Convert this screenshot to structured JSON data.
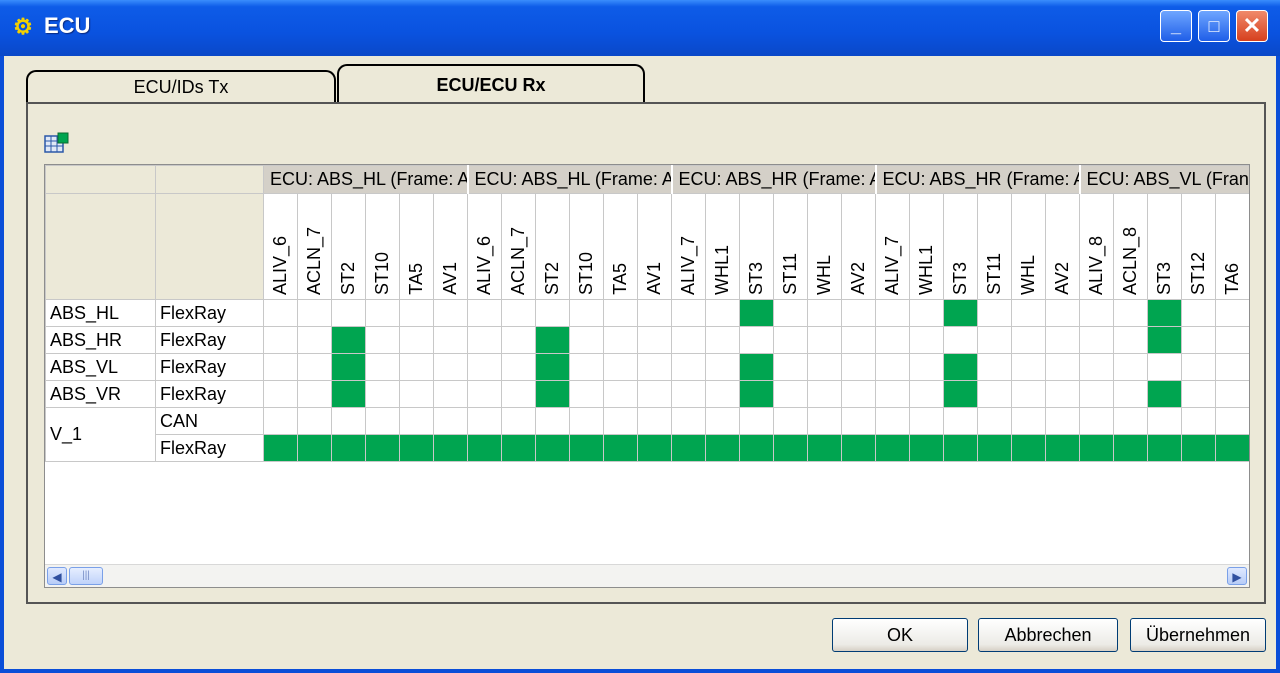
{
  "window": {
    "title": "ECU",
    "icon": "app-icon",
    "min_label": "_",
    "max_label": "□",
    "close_label": "✕"
  },
  "tabs": [
    {
      "label": "ECU/IDs Tx",
      "active": false
    },
    {
      "label": "ECU/ECU Rx",
      "active": true
    }
  ],
  "toolbar": {
    "icon": "grid-settings-icon"
  },
  "grid": {
    "groups": [
      {
        "label": "ECU: ABS_HL (Frame: A",
        "signals": [
          "ALIV_6",
          "ACLN_7",
          "ST2",
          "ST10",
          "TA5",
          "AV1"
        ]
      },
      {
        "label": "ECU: ABS_HL (Frame: A",
        "signals": [
          "ALIV_6",
          "ACLN_7",
          "ST2",
          "ST10",
          "TA5",
          "AV1"
        ]
      },
      {
        "label": "ECU: ABS_HR (Frame: A",
        "signals": [
          "ALIV_7",
          "WHL1",
          "ST3",
          "ST11",
          "WHL",
          "AV2"
        ]
      },
      {
        "label": "ECU: ABS_HR (Frame: A",
        "signals": [
          "ALIV_7",
          "WHL1",
          "ST3",
          "ST11",
          "WHL",
          "AV2"
        ]
      },
      {
        "label": "ECU: ABS_VL (Fran",
        "signals": [
          "ALIV_8",
          "ACLN_8",
          "ST3",
          "ST12",
          "TA6"
        ]
      }
    ],
    "rows": [
      {
        "ecu": "ABS_HL",
        "bus": "FlexRay",
        "on": [
          14,
          20,
          26
        ]
      },
      {
        "ecu": "ABS_HR",
        "bus": "FlexRay",
        "on": [
          2,
          8,
          26
        ]
      },
      {
        "ecu": "ABS_VL",
        "bus": "FlexRay",
        "on": [
          2,
          8,
          14,
          20
        ]
      },
      {
        "ecu": "ABS_VR",
        "bus": "FlexRay",
        "on": [
          2,
          8,
          14,
          20,
          26
        ]
      },
      {
        "ecu": "V_1",
        "bus": "CAN",
        "on": []
      },
      {
        "ecu": "",
        "bus": "FlexRay",
        "on": "all"
      }
    ],
    "on_color": "#00a550"
  },
  "buttons": {
    "ok": "OK",
    "cancel": "Abbrechen",
    "apply": "Übernehmen"
  }
}
